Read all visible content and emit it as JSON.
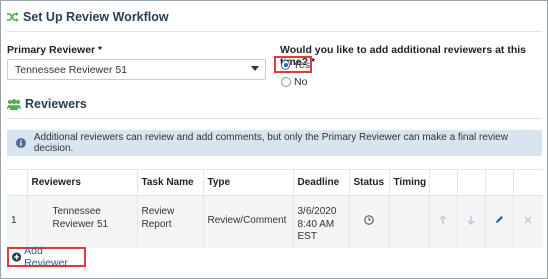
{
  "workflow": {
    "title": "Set Up Review Workflow",
    "primary_label": "Primary Reviewer *",
    "primary_value": "Tennessee Reviewer 51",
    "question": "Would you like to add additional reviewers at this time? *",
    "yes_label": "Yes",
    "no_label": "No",
    "selected": "Yes"
  },
  "reviewers": {
    "title": "Reviewers",
    "info_text": "Additional reviewers can review and add comments, but only the Primary Reviewer can make a final review decision.",
    "columns": [
      "Reviewers",
      "Task Name",
      "Type",
      "Deadline",
      "Status",
      "Timing"
    ],
    "rows": [
      {
        "num": "1",
        "reviewer": "Tennessee Reviewer 51",
        "task": "Review Report",
        "type": "Review/Comment",
        "deadline": "3/6/2020 8:40 AM EST",
        "timing": ""
      }
    ],
    "add_label": "Add Reviewer"
  },
  "colors": {
    "accent_green": "#4caf50",
    "link_blue": "#2c5d94",
    "highlight_red": "#e03a3a",
    "info_bg": "#d9e4f1"
  },
  "icons": {
    "workflow": "shuffle-icon",
    "reviewers": "users-icon",
    "info": "info-circle-icon",
    "status": "clock-icon",
    "move_up": "arrow-up-icon",
    "move_down": "arrow-down-icon",
    "edit": "pencil-icon",
    "remove": "close-icon",
    "add": "plus-circle-icon"
  }
}
